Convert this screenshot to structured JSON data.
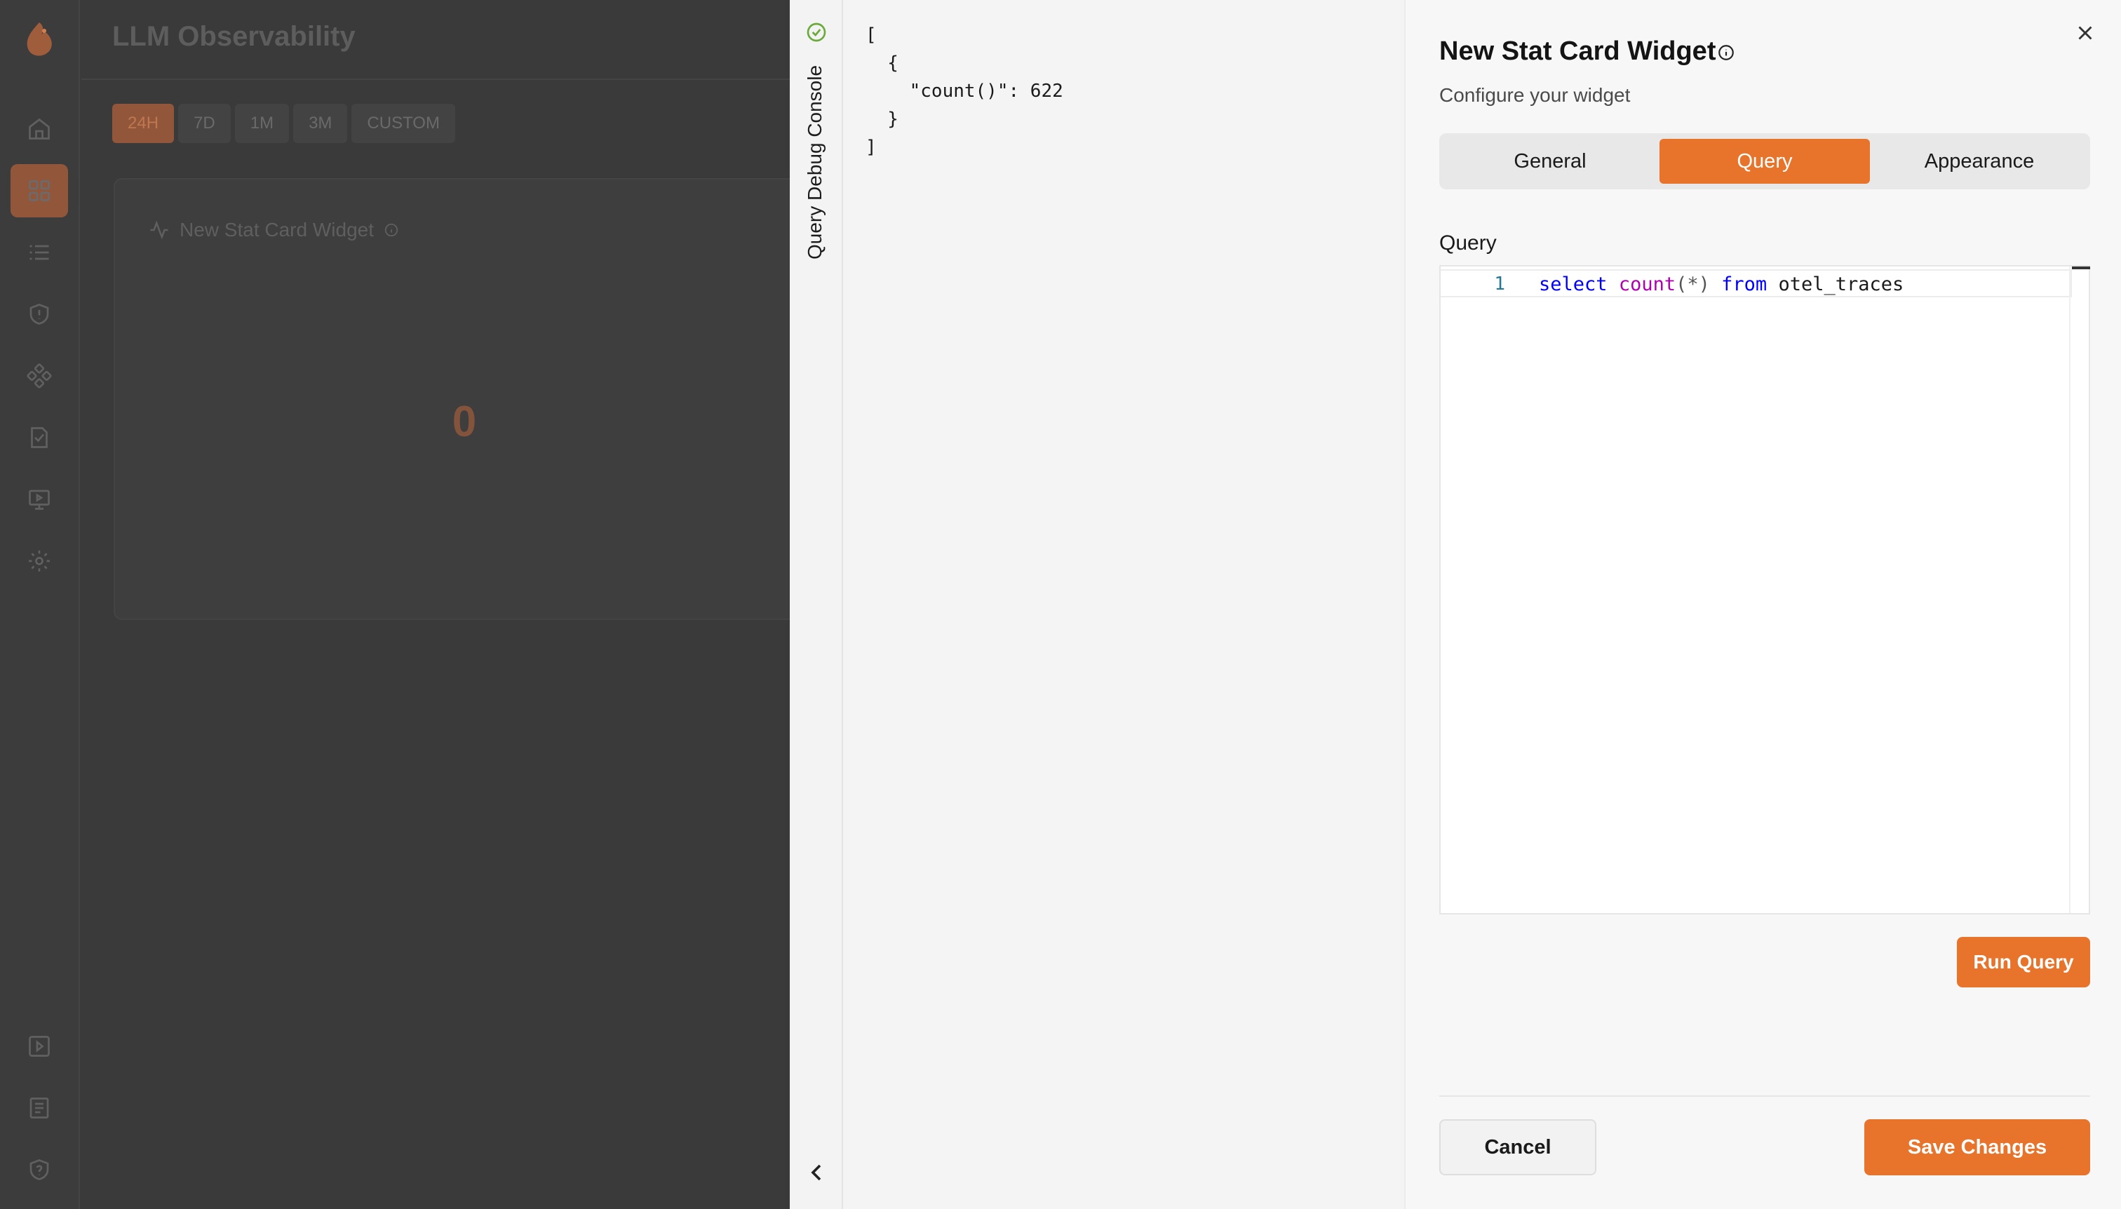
{
  "app": {
    "page_title": "LLM Observability",
    "nav_icons": [
      "home-icon",
      "dashboard-icon",
      "traces-icon",
      "guardrails-icon",
      "integrations-icon",
      "evaluations-icon",
      "playground-icon",
      "settings-icon",
      "docs-icon",
      "notes-icon",
      "security-icon"
    ],
    "range_tabs": [
      "24H",
      "7D",
      "1M",
      "3M",
      "CUSTOM"
    ],
    "active_range": "24H",
    "widget": {
      "title": "New Stat Card Widget",
      "value": "0"
    },
    "accent_color": "#e8742c"
  },
  "debug_console": {
    "label": "Query Debug Console",
    "status": "success",
    "output": "[\n  {\n    \"count()\": 622\n  }\n]"
  },
  "panel": {
    "title": "New Stat Card Widget",
    "subtitle": "Configure your widget",
    "tabs": [
      {
        "label": "General",
        "active": false
      },
      {
        "label": "Query",
        "active": true
      },
      {
        "label": "Appearance",
        "active": false
      }
    ],
    "query_label": "Query",
    "editor": {
      "line_number": "1",
      "tokens": {
        "kw1": "select",
        "fn": "count",
        "args": "(*)",
        "kw2": "from",
        "table": "otel_traces"
      }
    },
    "run_button": "Run Query",
    "cancel_button": "Cancel",
    "save_button": "Save Changes"
  }
}
